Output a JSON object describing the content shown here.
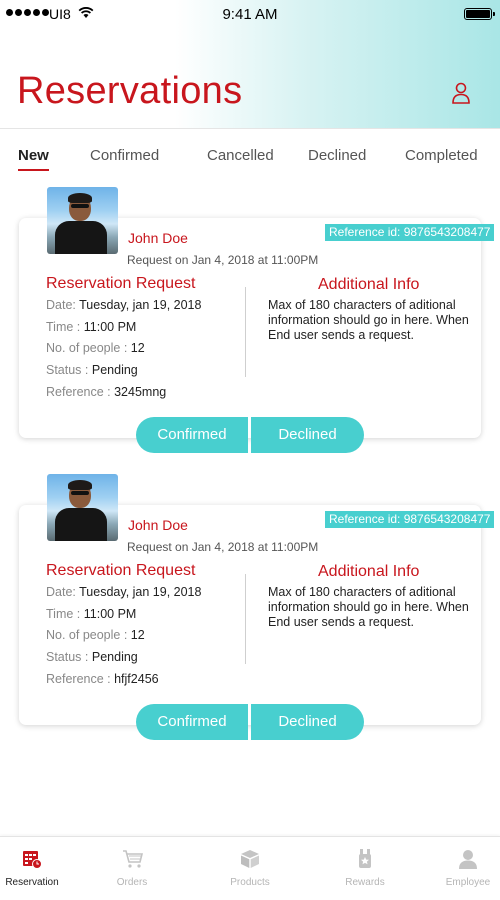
{
  "status_bar": {
    "carrier": "UI8",
    "time": "9:41 AM"
  },
  "header": {
    "title": "Reservations"
  },
  "tabs": [
    {
      "label": "New",
      "active": true
    },
    {
      "label": "Confirmed",
      "active": false
    },
    {
      "label": "Cancelled",
      "active": false
    },
    {
      "label": "Declined",
      "active": false
    },
    {
      "label": "Completed",
      "active": false
    }
  ],
  "reservations": [
    {
      "name": "John Doe",
      "requested_on": "Request on Jan 4, 2018 at 11:00PM",
      "reference_badge": "Reference id: 9876543208477",
      "section_title": "Reservation Request",
      "date_label": "Date:",
      "date_value": "Tuesday, jan 19, 2018",
      "time_label": "Time :",
      "time_value": "11:00 PM",
      "people_label": "No. of people :",
      "people_value": "12",
      "status_label": "Status :",
      "status_value": "Pending",
      "reference_label": "Reference :",
      "reference_value": "3245mng",
      "info_title": "Additional Info",
      "info_text": "Max of 180 characters of aditional information should go in here. When End user sends a request.",
      "confirm_label": "Confirmed",
      "decline_label": "Declined"
    },
    {
      "name": "John Doe",
      "requested_on": "Request on Jan 4, 2018 at 11:00PM",
      "reference_badge": "Reference id: 9876543208477",
      "section_title": "Reservation Request",
      "date_label": "Date:",
      "date_value": "Tuesday, jan 19, 2018",
      "time_label": "Time :",
      "time_value": "11:00 PM",
      "people_label": "No. of people :",
      "people_value": "12",
      "status_label": "Status :",
      "status_value": "Pending",
      "reference_label": "Reference :",
      "reference_value": "hfjf2456",
      "info_title": "Additional Info",
      "info_text": "Max of 180 characters of aditional information should go in here. When End user sends a request.",
      "confirm_label": "Confirmed",
      "decline_label": "Declined"
    }
  ],
  "bottom_nav": [
    {
      "label": "Reservation",
      "icon": "reservation-icon",
      "active": true
    },
    {
      "label": "Orders",
      "icon": "cart-icon",
      "active": false
    },
    {
      "label": "Products",
      "icon": "box-icon",
      "active": false
    },
    {
      "label": "Rewards",
      "icon": "medal-icon",
      "active": false
    },
    {
      "label": "Employee",
      "icon": "person-icon",
      "active": false
    }
  ],
  "colors": {
    "brand_red": "#c8161d",
    "accent_teal": "#48cfcf"
  }
}
